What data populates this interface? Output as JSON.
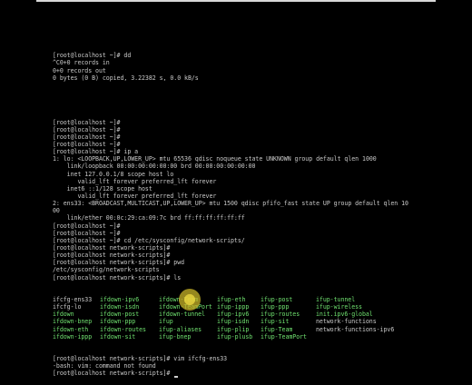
{
  "terminal": {
    "lines_block1": [
      "[root@localhost ~]# dd",
      "^C0+0 records in",
      "0+0 records out",
      "0 bytes (0 B) copied, 3.22382 s, 0.0 kB/s"
    ],
    "lines_block2": [
      "[root@localhost ~]#",
      "[root@localhost ~]#",
      "[root@localhost ~]#",
      "[root@localhost ~]#",
      "[root@localhost ~]# ip a",
      "1: lo: <LOOPBACK,UP,LOWER_UP> mtu 65536 qdisc noqueue state UNKNOWN group default qlen 1000",
      "    link/loopback 00:00:00:00:00:00 brd 00:00:00:00:00:00",
      "    inet 127.0.0.1/8 scope host lo",
      "       valid_lft forever preferred_lft forever",
      "    inet6 ::1/128 scope host",
      "       valid_lft forever preferred_lft forever",
      "2: ens33: <BROADCAST,MULTICAST,UP,LOWER_UP> mtu 1500 qdisc pfifo_fast state UP group default qlen 10",
      "00",
      "    link/ether 00:0c:29:ca:09:7c brd ff:ff:ff:ff:ff:ff",
      "[root@localhost ~]#",
      "[root@localhost ~]#",
      "[root@localhost ~]# cd /etc/sysconfig/network-scripts/",
      "[root@localhost network-scripts]#",
      "[root@localhost network-scripts]#",
      "[root@localhost network-scripts]# pwd",
      "/etc/sysconfig/network-scripts",
      "[root@localhost network-scripts]# ls"
    ],
    "ls_rows": [
      [
        "ifcfg-ens33",
        "ifdown-ipv6",
        "ifdown-Team",
        "ifup-eth",
        "ifup-post",
        "ifup-tunnel"
      ],
      [
        "ifcfg-lo",
        "ifdown-isdn",
        "ifdown-TeamPort",
        "ifup-ippp",
        "ifup-ppp",
        "ifup-wireless"
      ],
      [
        "ifdown",
        "ifdown-post",
        "ifdown-tunnel",
        "ifup-ipv6",
        "ifup-routes",
        "init.ipv6-global"
      ],
      [
        "ifdown-bnep",
        "ifdown-ppp",
        "ifup",
        "ifup-isdn",
        "ifup-sit",
        "network-functions"
      ],
      [
        "ifdown-eth",
        "ifdown-routes",
        "ifup-aliases",
        "ifup-plip",
        "ifup-Team",
        "network-functions-ipv6"
      ],
      [
        "ifdown-ippp",
        "ifdown-sit",
        "ifup-bnep",
        "ifup-plusb",
        "ifup-TeamPort",
        ""
      ]
    ],
    "lines_block3": [
      "[root@localhost network-scripts]# vim ifcfg-ens33",
      "-bash: vim: command not found",
      "[root@localhost network-scripts]# "
    ]
  },
  "colors": {
    "background": "#000000",
    "text": "#c8c8c8",
    "config_file": "#5fe0d0",
    "executable": "#6fe06f",
    "mouse_highlight": "#e6d23c"
  }
}
